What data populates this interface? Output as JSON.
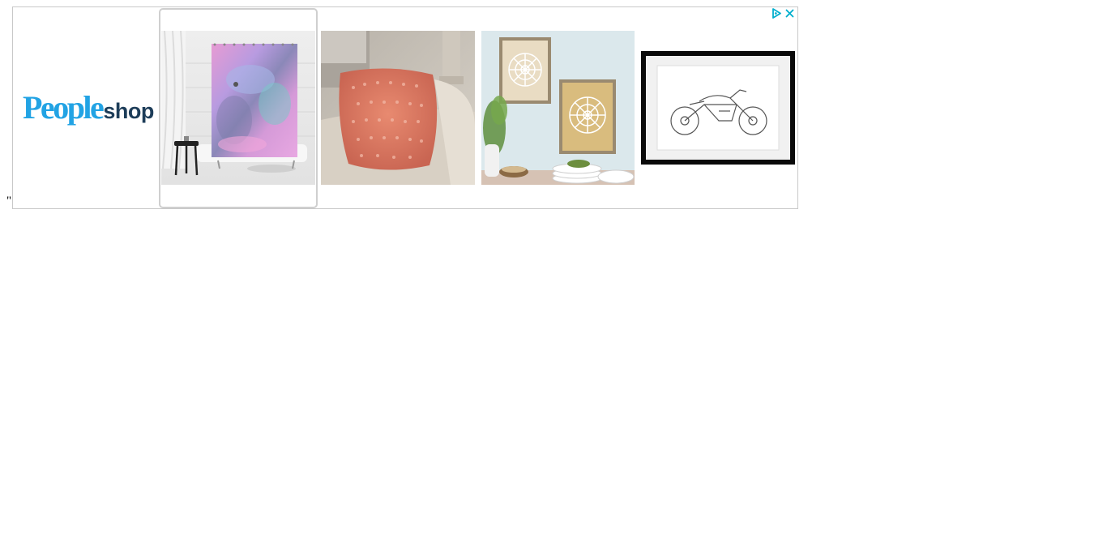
{
  "stray_text": "\"",
  "ad": {
    "logo": {
      "brand_word": "People",
      "suffix_word": "shop"
    },
    "products": [
      {
        "icon": "shower-curtain-image"
      },
      {
        "icon": "knit-pillow-image"
      },
      {
        "icon": "framed-mandala-wall-art-image"
      },
      {
        "icon": "framed-motorcycle-sketch-image"
      }
    ],
    "adchoices": {
      "icon": "adchoices-play-icon",
      "close_icon": "close-icon"
    },
    "colors": {
      "brand_blue": "#22a3e4",
      "brand_navy": "#1d3d59",
      "adchoices": "#00aecd"
    }
  }
}
